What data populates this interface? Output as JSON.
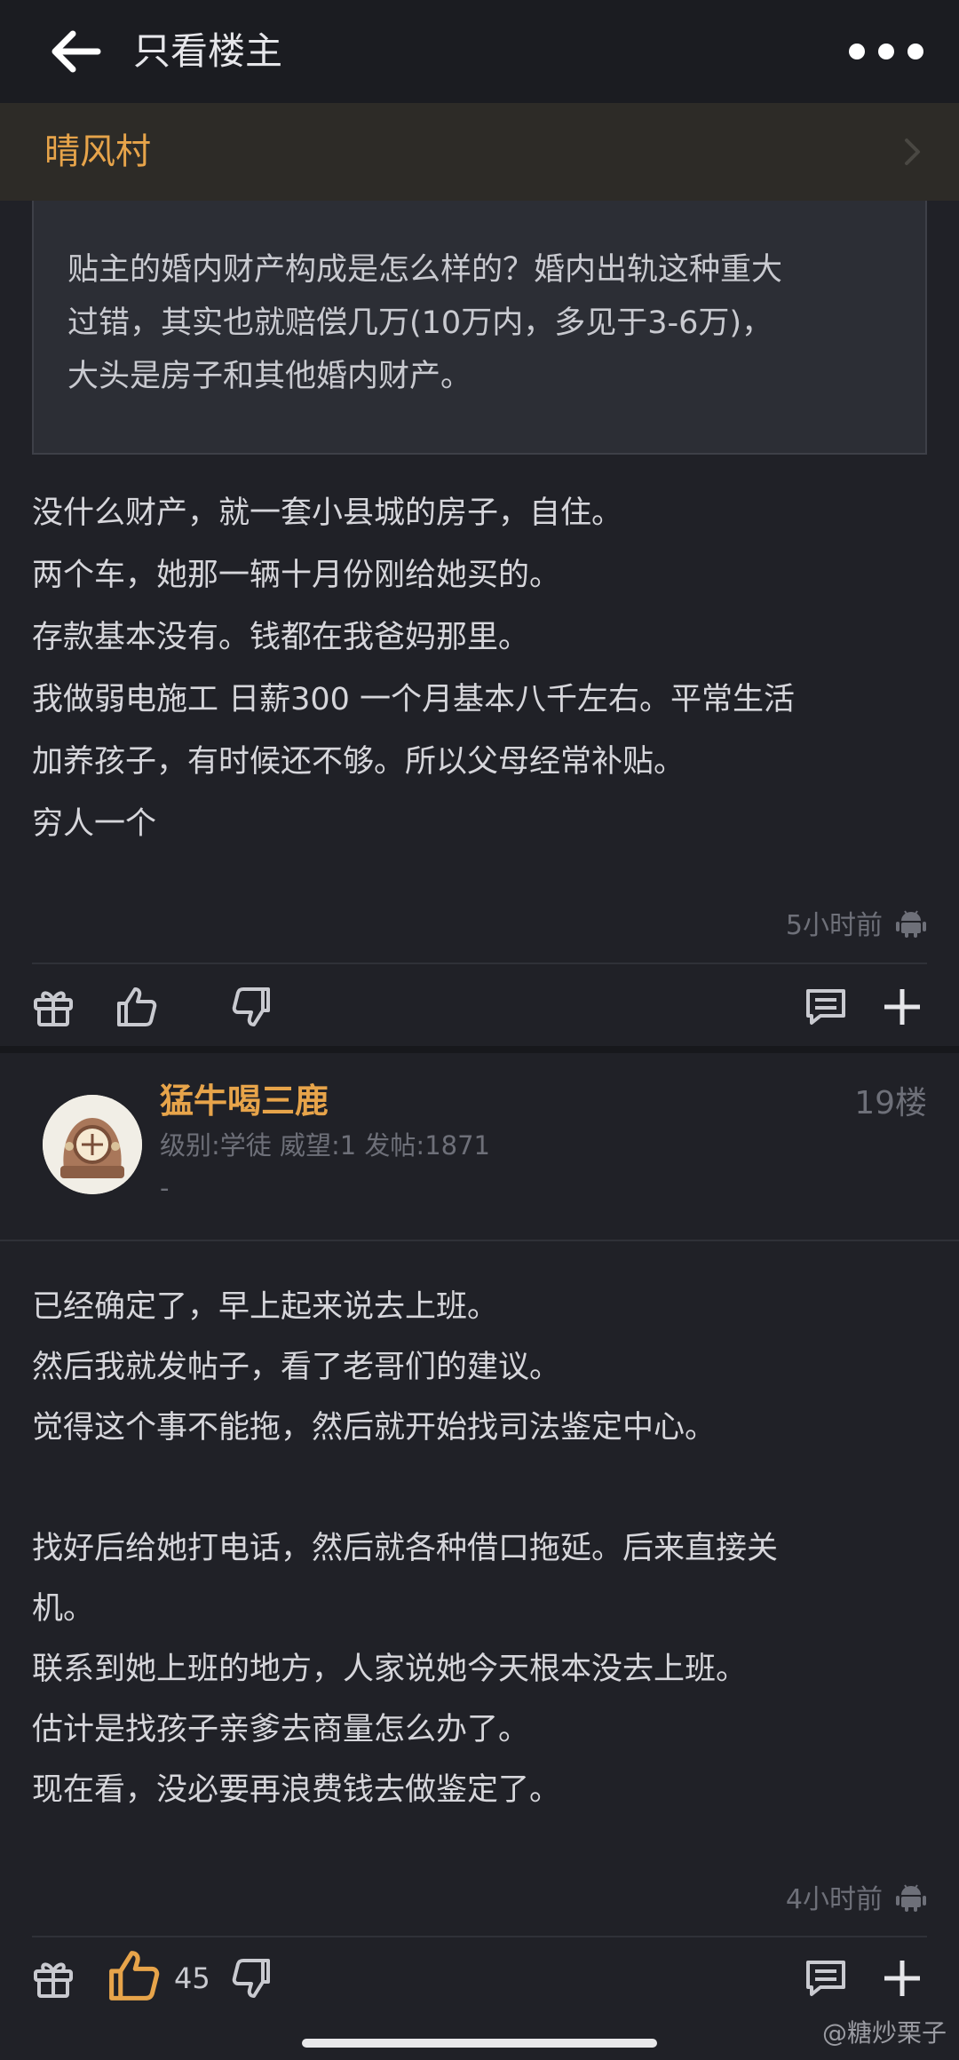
{
  "header": {
    "title": "只看楼主"
  },
  "forum": {
    "name": "晴风村"
  },
  "quote": {
    "lines": [
      "贴主的婚内财产构成是怎么样的？婚内出轨这种重大",
      "过错，其实也就赔偿几万(10万内，多见于3-6万)，",
      "大头是房子和其他婚内财产。"
    ]
  },
  "post1": {
    "lines": [
      "没什么财产，就一套小县城的房子，自住。",
      "两个车，她那一辆十月份刚给她买的。",
      "存款基本没有。钱都在我爸妈那里。",
      "我做弱电施工 日薪300 一个月基本八千左右。平常生活",
      "加养孩子，有时候还不够。所以父母经常补贴。",
      "穷人一个"
    ],
    "time": "5小时前"
  },
  "post2": {
    "username": "猛牛喝三鹿",
    "meta": "级别:学徒 威望:1 发帖:1871",
    "signature": "-",
    "floor": "19楼",
    "lines": [
      "已经确定了，早上起来说去上班。",
      "然后我就发帖子，看了老哥们的建议。",
      "觉得这个事不能拖，然后就开始找司法鉴定中心。",
      "",
      "找好后给她打电话，然后就各种借口拖延。后来直接关",
      "机。",
      "联系到她上班的地方，人家说她今天根本没去上班。",
      "估计是找孩子亲爹去商量怎么办了。",
      "现在看，没必要再浪费钱去做鉴定了。"
    ],
    "time": "4小时前",
    "like_count": "45"
  },
  "watermark": "@糖炒栗子",
  "colors": {
    "accent": "#e7a44a",
    "background": "#202127",
    "like_active": "#e7a44a"
  }
}
